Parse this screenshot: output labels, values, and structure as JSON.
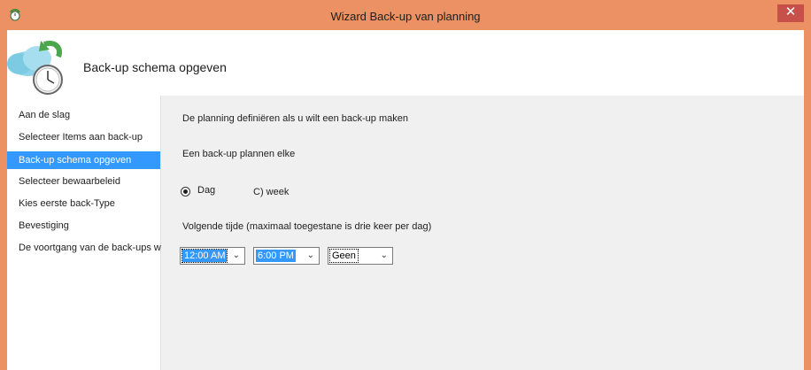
{
  "window": {
    "title": "Wizard Back-up van planning",
    "close_glyph": "✕"
  },
  "header": {
    "heading": "Back-up schema opgeven"
  },
  "sidebar": {
    "steps": [
      {
        "label": "Aan de slag",
        "active": false
      },
      {
        "label": "Selecteer Items aan back-up",
        "active": false
      },
      {
        "label": "Back-up schema opgeven",
        "active": true
      },
      {
        "label": "Selecteer bewaarbeleid",
        "active": false
      },
      {
        "label": "Kies eerste back-Type",
        "active": false
      },
      {
        "label": "Bevestiging",
        "active": false
      },
      {
        "label": "De voortgang van de back-ups wijzigen",
        "active": false
      }
    ]
  },
  "main": {
    "intro": "De planning definiëren als u wilt een back-up maken",
    "frequency_label": "Een back-up plannen elke",
    "options": [
      {
        "label": "Dag",
        "selected": true
      },
      {
        "label": "C) week",
        "selected": false
      }
    ],
    "times_label": "Volgende tijde (maximaal toegestane is drie keer per dag)",
    "time_selects": [
      {
        "value": "12:00 AM"
      },
      {
        "value": "6:00 PM"
      },
      {
        "value": "Geen"
      }
    ]
  },
  "icons": {
    "app": "cloud-clock-icon",
    "wizard": "cloud-backup-clock-icon",
    "close": "close-icon",
    "dropdown": "chevron-down-icon"
  },
  "colors": {
    "frame": "#eb9163",
    "selection": "#3399ff",
    "close_button": "#c7504a"
  }
}
